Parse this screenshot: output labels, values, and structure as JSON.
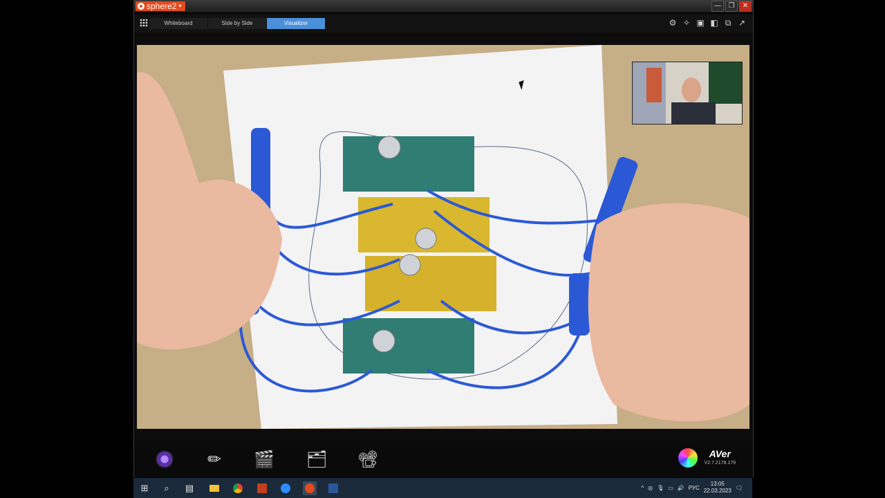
{
  "app": {
    "name": "sphere2"
  },
  "window_controls": {
    "minimize": "—",
    "restore": "❐",
    "close": "✕"
  },
  "modes": {
    "tabs": [
      {
        "label": "Whiteboard"
      },
      {
        "label": "Side by Side"
      },
      {
        "label": "Visualizer"
      }
    ],
    "active": "Visualizer"
  },
  "toolbar_icons": [
    "camera-settings-icon",
    "freeze-icon",
    "layout-icon",
    "split-icon",
    "export-icon",
    "popout-icon"
  ],
  "dock": {
    "items": [
      "camera-lens-icon",
      "annotate-pencil-icon",
      "video-clapper-icon",
      "snapshot-icon",
      "presentation-icon"
    ]
  },
  "brand": {
    "logo": "AVer",
    "version": "V2.7.2178.179"
  },
  "taskbar": {
    "clock_time": "13:05",
    "clock_date": "22.03.2023",
    "language": "РУС",
    "apps": [
      "windows-start-icon",
      "search-icon",
      "task-view-icon",
      "file-explorer-icon",
      "chrome-icon",
      "powerpoint-icon",
      "zoom-icon",
      "sphere2-icon",
      "word-icon"
    ]
  },
  "colors": {
    "accent": "#4a8fd9",
    "brand": "#e24b1e",
    "taskbar": "#1b2a3a"
  }
}
